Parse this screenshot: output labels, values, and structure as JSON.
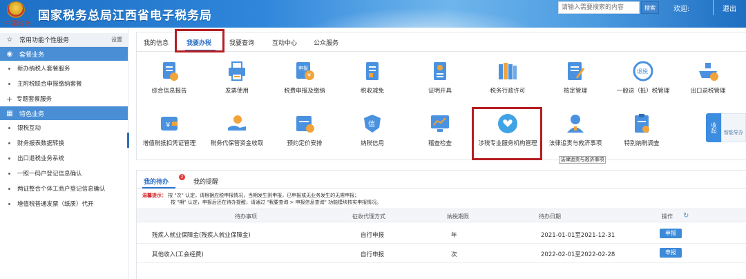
{
  "header": {
    "title": "国家税务总局江西省电子税务局",
    "emblem_text": "中国税务",
    "search_placeholder": "请输入需要搜索的内容",
    "search_button": "搜索",
    "welcome": "欢迎:",
    "logout": "退出"
  },
  "sidebar": {
    "common_label": "常用功能个性服务",
    "setting_label": "设置",
    "package_label": "套餐业务",
    "package_items": [
      "新办纳税人套餐服务",
      "主附税联合申报缴纳套餐"
    ],
    "special_pkg_label": "专题套餐服务",
    "featured_label": "特色业务",
    "featured_items": [
      "银税互动",
      "财务报表数据转换",
      "出口退税业务系统",
      "一照一码户登记信息确认",
      "两证整合个体工商户登记信息确认",
      "增值税普通发票（纸质）代开"
    ]
  },
  "main": {
    "tabs": [
      "我的信息",
      "我要办税",
      "我要查询",
      "互动中心",
      "公众服务"
    ],
    "services_row1": [
      "综合信息报告",
      "发票使用",
      "税费申报及缴纳",
      "税收减免",
      "证明开具",
      "税务行政许可",
      "核定管理",
      "一般退（抵）税管理",
      "出口退税管理"
    ],
    "services_row2": [
      "增值税抵扣凭证管理",
      "税务代保管资金收取",
      "预约定价安排",
      "纳税信用",
      "稽查检查",
      "涉税专业服务机构管理",
      "法律追责与救济事项",
      "特别纳税调查"
    ],
    "tooltip": "法律追责与救济事项",
    "side_tab": "收起",
    "side_card": "智能导办"
  },
  "todo": {
    "tabs": [
      "我的待办",
      "我的提醒"
    ],
    "badge": "2",
    "notice_label": "温馨提示：",
    "notice_line1": "按 \"次\" 认定，请根据应税申报情况，当期发生则申报，已申报或无业务发生的无需申报；",
    "notice_line2": "按 \"期\" 认定，申报后还在待办提醒，请通过 \"我要查询 > 申报信息查询\" 功能模块核实申报情况。",
    "columns": [
      "待办事项",
      "征收代理方式",
      "纳税期限",
      "待办日期",
      "操作"
    ],
    "rows": [
      {
        "item": "残疾人就业保障金(残疾人就业保障金)",
        "method": "自行申报",
        "period": "年",
        "date": "2021-01-01至2021-12-31",
        "action": "申报"
      },
      {
        "item": "其他收入(工会经费)",
        "method": "自行申报",
        "period": "次",
        "date": "2022-02-01至2022-02-28",
        "action": "申报"
      }
    ]
  }
}
